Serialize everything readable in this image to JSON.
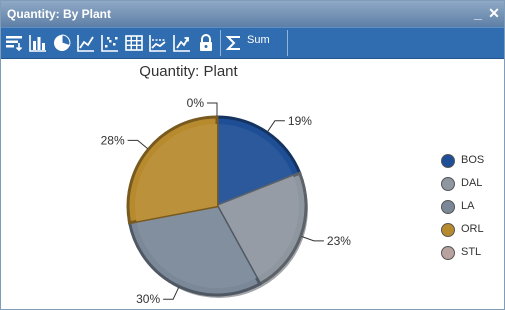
{
  "window": {
    "title": "Quantity: By  Plant",
    "minimize_glyph": "_",
    "close_glyph": "✕"
  },
  "toolbar": {
    "icons": [
      "sort-icon",
      "bar-chart-icon",
      "pie-chart-icon",
      "line-chart-icon",
      "scatter-chart-icon",
      "grid-table-icon",
      "trend-chart-icon",
      "export-icon",
      "lock-icon",
      "sigma-icon"
    ],
    "sum_label": "Sum",
    "colors": {
      "bar": "#2f6db0",
      "icon": "#ffffff"
    }
  },
  "chart_data": {
    "type": "pie",
    "title": "Quantity: Plant",
    "categories": [
      "BOS",
      "DAL",
      "LA",
      "ORL",
      "STL"
    ],
    "values": [
      19,
      23,
      30,
      28,
      0
    ],
    "labels": [
      "19%",
      "23%",
      "30%",
      "28%",
      "0%"
    ],
    "colors": [
      "#1e4e95",
      "#8e969f",
      "#7a8898",
      "#b88a2e",
      "#b8a39e"
    ],
    "legend_position": "right"
  }
}
